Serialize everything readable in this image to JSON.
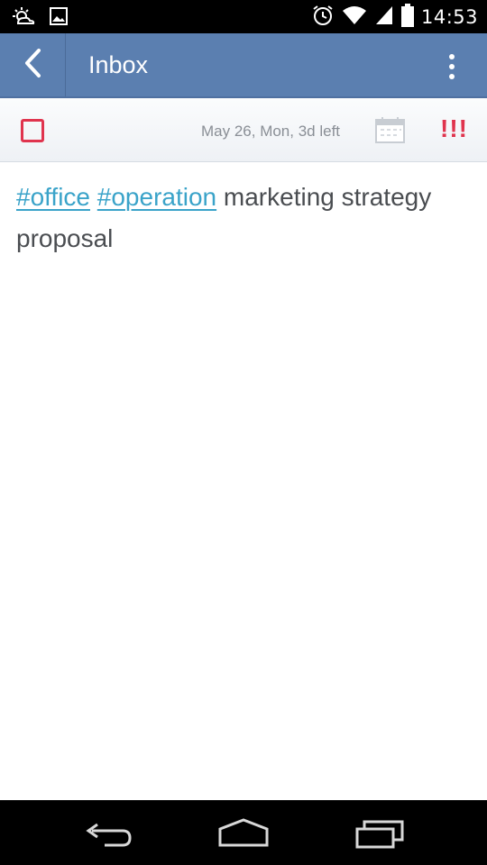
{
  "status_bar": {
    "left_icons": [
      "weather-icon",
      "image-icon"
    ],
    "right_icons": [
      "alarm-icon",
      "wifi-icon",
      "signal-icon",
      "battery-icon"
    ],
    "time": "14:53"
  },
  "app_bar": {
    "title": "Inbox",
    "back_icon": "back-arrow-icon",
    "menu_icon": "overflow-menu-icon",
    "color": "#5b7fb0"
  },
  "task_toolbar": {
    "checked": false,
    "due_label": "May 26, Mon, 3d left",
    "calendar_icon": "calendar-icon",
    "priority_label": "!!!",
    "accent_color": "#e0344e"
  },
  "task": {
    "tags": [
      "#office",
      "#operation"
    ],
    "text": "marketing strategy proposal",
    "tag_color": "#3aa3c9"
  },
  "nav_bar": {
    "buttons": [
      "back-nav-icon",
      "home-nav-icon",
      "recents-nav-icon"
    ]
  }
}
